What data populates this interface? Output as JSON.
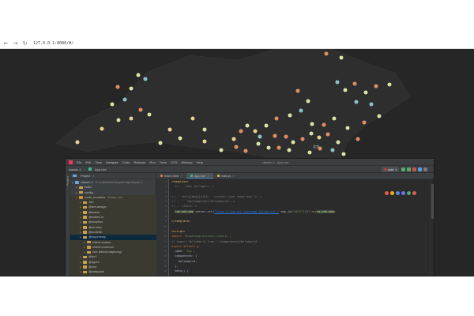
{
  "browser": {
    "url": "127.0.0.1:8080/#/",
    "back_icon": "arrow-left",
    "forward_icon": "arrow-right",
    "reload_icon": "reload"
  },
  "map": {
    "background_color": "#262626",
    "land_color": "#2e2e2e",
    "label": "北京"
  },
  "ide": {
    "menu": [
      "File",
      "Edit",
      "View",
      "Navigate",
      "Code",
      "Refactor",
      "Run",
      "Tools",
      "VCS",
      "Window",
      "Help"
    ],
    "window_title": "classic-1 - App.vue",
    "breadcrumb_project": "classic-1",
    "breadcrumb_file": "App.vue",
    "run_config": "start",
    "project_pane_title": "Project",
    "tree": [
      {
        "label": "classic-1",
        "hint": "E:\\code\\demo\\supermap\\classic-1",
        "level": 0,
        "kind": "blue",
        "style": ""
      },
      {
        "label": "build",
        "hint": "",
        "level": 1,
        "kind": "folder",
        "style": ""
      },
      {
        "label": "config",
        "hint": "",
        "level": 1,
        "kind": "folder",
        "style": ""
      },
      {
        "label": "node_modules",
        "hint": "library root",
        "level": 1,
        "kind": "orange",
        "style": "muted"
      },
      {
        "label": ".bin",
        "hint": "",
        "level": 2,
        "kind": "folder",
        "style": "muted"
      },
      {
        "label": "@ant-design",
        "hint": "",
        "level": 2,
        "kind": "folder",
        "style": "muted"
      },
      {
        "label": "@babel",
        "hint": "",
        "level": 2,
        "kind": "folder",
        "style": "muted"
      },
      {
        "label": "@iclient-ol",
        "hint": "",
        "level": 2,
        "kind": "folder",
        "style": "muted"
      },
      {
        "label": "@mapbox",
        "hint": "",
        "level": 2,
        "kind": "folder",
        "style": "muted"
      },
      {
        "label": "@mrmlnc",
        "hint": "",
        "level": 2,
        "kind": "folder",
        "style": "muted"
      },
      {
        "label": "@nodelib",
        "hint": "",
        "level": 2,
        "kind": "folder",
        "style": "muted"
      },
      {
        "label": "@supermap",
        "hint": "",
        "level": 2,
        "kind": "folder",
        "style": "sel"
      },
      {
        "label": "iclient-classic",
        "hint": "",
        "level": 3,
        "kind": "folder",
        "style": "muted"
      },
      {
        "label": "iclient-common",
        "hint": "",
        "level": 3,
        "kind": "folder",
        "style": "muted"
      },
      {
        "label": "vue-iclient-mapboxgl",
        "hint": "",
        "level": 3,
        "kind": "folder",
        "style": "muted"
      },
      {
        "label": "@turf",
        "hint": "",
        "level": 2,
        "kind": "folder",
        "style": "muted"
      },
      {
        "label": "@types",
        "hint": "",
        "level": 2,
        "kind": "folder",
        "style": "muted"
      },
      {
        "label": "@vue",
        "hint": "",
        "level": 2,
        "kind": "folder",
        "style": "muted"
      },
      {
        "label": "@webpack",
        "hint": "",
        "level": 2,
        "kind": "folder",
        "style": "muted"
      },
      {
        "label": "@xtuc",
        "hint": "",
        "level": 2,
        "kind": "folder",
        "style": "muted"
      }
    ],
    "tabs": [
      {
        "label": "index.html",
        "color": "#e8754a",
        "active": false
      },
      {
        "label": "App.vue",
        "color": "#41b883",
        "active": true
      },
      {
        "label": "main.js",
        "color": "#d6b94a",
        "active": false
      }
    ],
    "line_numbers": [
      "1",
      "2",
      "3",
      "4",
      "5",
      "6",
      "7",
      "8",
      "9",
      "10",
      "11",
      "12",
      "13",
      "14",
      "15",
      "16",
      "17",
      "18",
      "19",
      "20"
    ],
    "code_lines": [
      [
        {
          "t": "<template>",
          "c": "c-tag"
        }
      ],
      [
        {
          "t": "  <!--  <div id=\"app\">-->",
          "c": "c-com"
        }
      ],
      [
        {
          "t": "",
          "c": "c-plain"
        }
      ],
      [
        {
          "t": "<!--  <h1>{{msg}}</h1>   <router-view :msg='msg'/>-->",
          "c": "c-com"
        }
      ],
      [
        {
          "t": "<!--     <HelloWorld></HelloWorld>-->",
          "c": "c-com"
        }
      ],
      [
        {
          "t": "<!--  </div>-->",
          "c": "c-com"
        }
      ],
      [
        {
          "t": "  ",
          "c": "c-plain"
        },
        {
          "t": "<sm-web-map",
          "c": "c-tag c-hl"
        },
        {
          "t": " server-url=",
          "c": "c-attr"
        },
        {
          "t": "\"https://iportal.supermap.io/iportal/\"",
          "c": "c-url"
        },
        {
          "t": " map-id=",
          "c": "c-attr"
        },
        {
          "t": "\"801571284\"",
          "c": "c-str"
        },
        {
          "t": "></",
          "c": "c-tag"
        },
        {
          "t": "sm-web-map",
          "c": "c-tag c-hl"
        },
        {
          "t": ">",
          "c": "c-tag"
        }
      ],
      [
        {
          "t": "",
          "c": "c-plain"
        }
      ],
      [
        {
          "t": "</template>",
          "c": "c-tag"
        }
      ],
      [
        {
          "t": "",
          "c": "c-plain"
        }
      ],
      [
        {
          "t": "<script>",
          "c": "c-tag"
        }
      ],
      [
        {
          "t": "import ",
          "c": "c-kw"
        },
        {
          "t": "'@supermap/iclient-classic'",
          "c": "c-str"
        },
        {
          "t": ";",
          "c": "c-kw"
        }
      ],
      [
        {
          "t": "// ",
          "c": "c-com"
        },
        {
          "t": "import HelloWorld from './components/HelloWorld'",
          "c": "c-com"
        }
      ],
      [
        {
          "t": "export default ",
          "c": "c-kw"
        },
        {
          "t": "{",
          "c": "c-plain"
        }
      ],
      [
        {
          "t": "  name: ",
          "c": "c-plain"
        },
        {
          "t": "'App'",
          "c": "c-str"
        },
        {
          "t": ",",
          "c": "c-kw"
        }
      ],
      [
        {
          "t": "  components: {",
          "c": "c-plain"
        }
      ],
      [
        {
          "t": "    HelloWorld,",
          "c": "c-plain"
        }
      ],
      [
        {
          "t": "  },",
          "c": "c-plain"
        }
      ],
      [
        {
          "t": "  data() {",
          "c": "c-plain"
        }
      ],
      [
        {
          "t": "",
          "c": "c-plain"
        }
      ]
    ],
    "browser_icon_colors": [
      "#e55b4b",
      "#f5a623",
      "#4a90d9",
      "#7b68ee",
      "#3cb371",
      "#e55b4b"
    ],
    "colors": {
      "editor_bg": "#2b2b2b",
      "panel_bg": "#3c3f41",
      "selection": "#0d293e"
    }
  }
}
